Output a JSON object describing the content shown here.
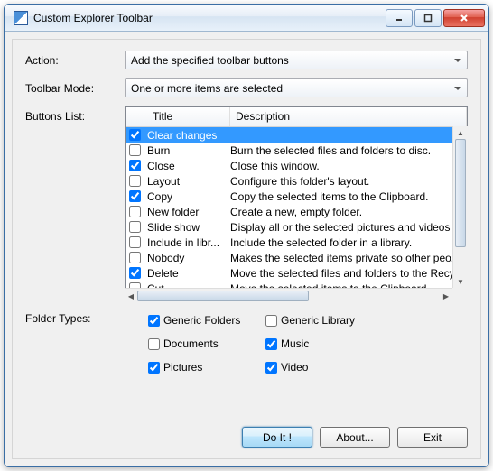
{
  "window": {
    "title": "Custom Explorer Toolbar"
  },
  "labels": {
    "action": "Action:",
    "toolbar_mode": "Toolbar Mode:",
    "buttons_list": "Buttons List:",
    "folder_types": "Folder Types:"
  },
  "combos": {
    "action": "Add the specified toolbar buttons",
    "toolbar_mode": "One or more items are selected"
  },
  "list": {
    "headers": {
      "title": "Title",
      "description": "Description"
    },
    "rows": [
      {
        "checked": true,
        "selected": true,
        "title": "Clear changes",
        "desc": ""
      },
      {
        "checked": false,
        "selected": false,
        "title": "Burn",
        "desc": "Burn the selected files and folders to disc."
      },
      {
        "checked": true,
        "selected": false,
        "title": "Close",
        "desc": "Close this window."
      },
      {
        "checked": false,
        "selected": false,
        "title": "Layout",
        "desc": "Configure this folder's layout."
      },
      {
        "checked": true,
        "selected": false,
        "title": "Copy",
        "desc": "Copy the selected items to the Clipboard."
      },
      {
        "checked": false,
        "selected": false,
        "title": "New folder",
        "desc": "Create a new, empty folder."
      },
      {
        "checked": false,
        "selected": false,
        "title": "Slide show",
        "desc": "Display all or the selected pictures and videos i.."
      },
      {
        "checked": false,
        "selected": false,
        "title": "Include in libr...",
        "desc": "Include the selected folder in a library."
      },
      {
        "checked": false,
        "selected": false,
        "title": "Nobody",
        "desc": "Makes the selected items private so other peo..."
      },
      {
        "checked": true,
        "selected": false,
        "title": "Delete",
        "desc": "Move the selected files and folders to the Recy."
      },
      {
        "checked": false,
        "selected": false,
        "title": "Cut",
        "desc": "Move the selected items to the Clipboard."
      }
    ]
  },
  "folder_types": [
    {
      "label": "Generic Folders",
      "checked": true
    },
    {
      "label": "Generic Library",
      "checked": false
    },
    {
      "label": "Documents",
      "checked": false
    },
    {
      "label": "Music",
      "checked": true
    },
    {
      "label": "Pictures",
      "checked": true
    },
    {
      "label": "Video",
      "checked": true
    }
  ],
  "buttons": {
    "do_it": "Do It !",
    "about": "About...",
    "exit": "Exit"
  }
}
